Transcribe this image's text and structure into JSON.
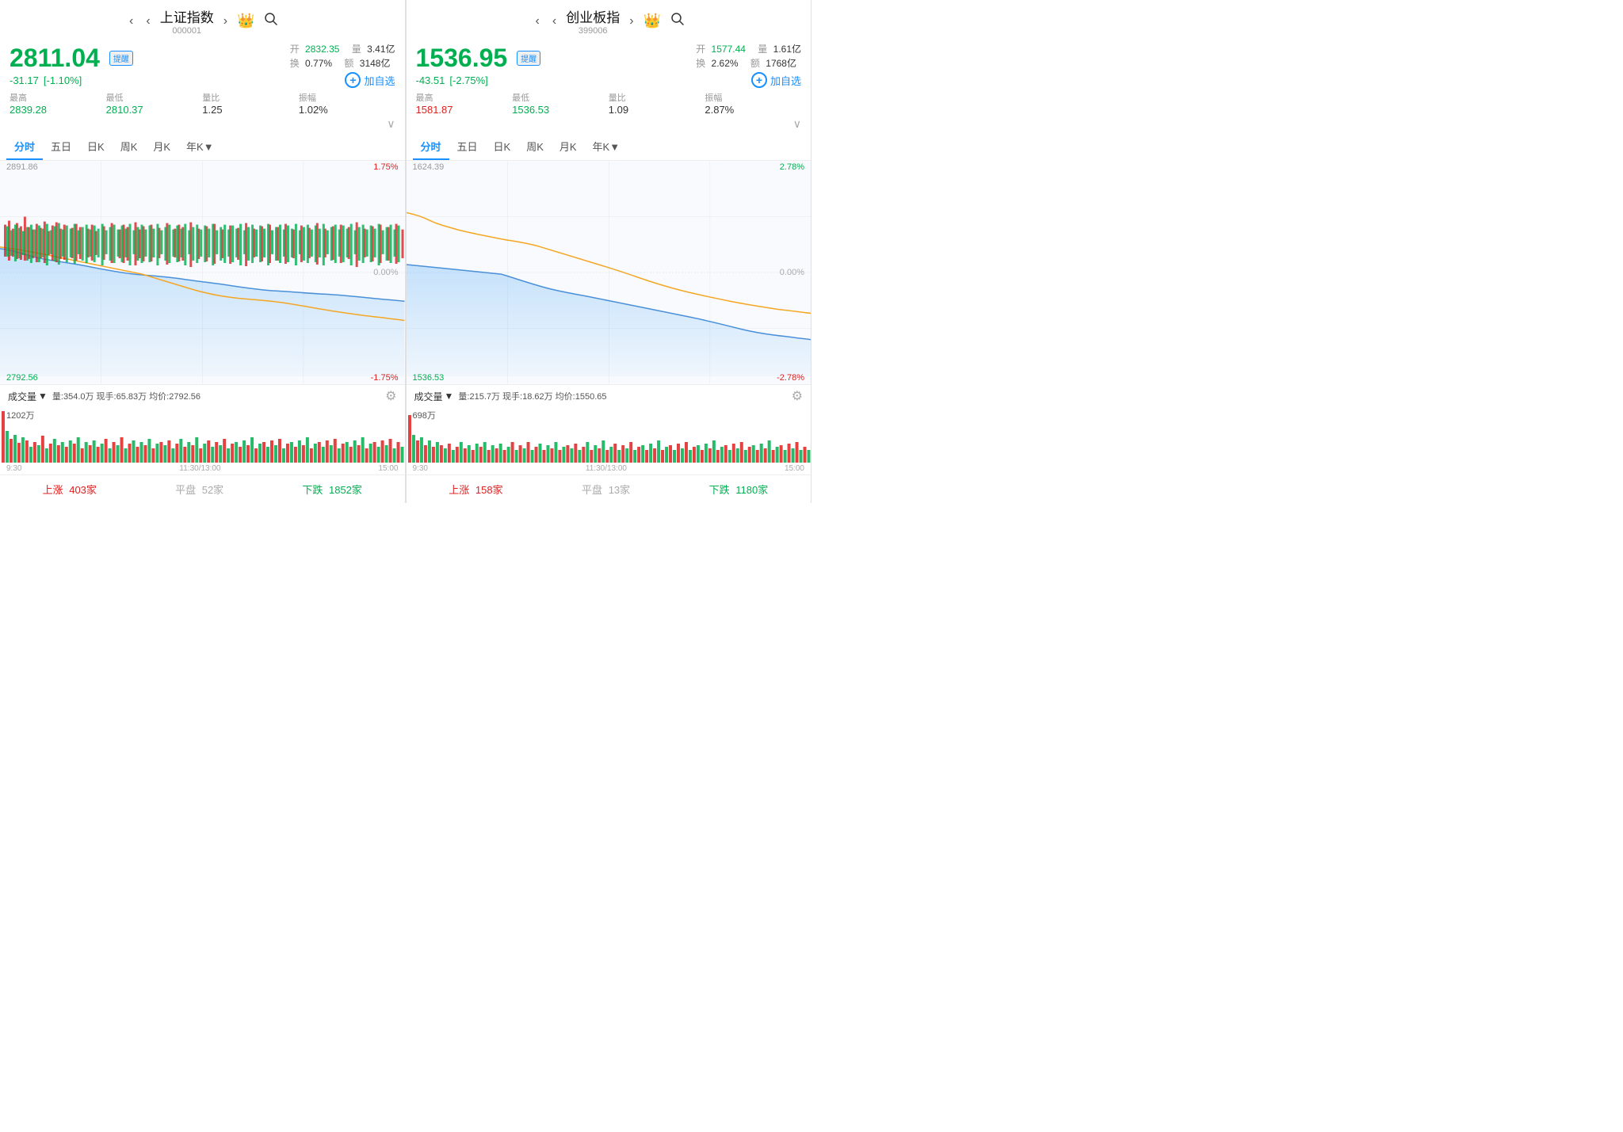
{
  "left": {
    "title": "上证指数",
    "code": "000001",
    "price": "2811.04",
    "change": "-31.17",
    "changePct": "[-1.10%]",
    "alertLabel": "提醒",
    "addLabel": "加自选",
    "open": "2832.35",
    "openLabel": "开",
    "volume": "3.41亿",
    "volumeLabel": "量",
    "turnover": "0.77%",
    "turnoverLabel": "换",
    "amount": "3148亿",
    "amountLabel": "额",
    "high": "2839.28",
    "highLabel": "最高",
    "low": "2810.37",
    "lowLabel": "最低",
    "volRatio": "1.25",
    "volRatioLabel": "量比",
    "amplitude": "1.02%",
    "amplitudeLabel": "振幅",
    "chartTopLeft": "2891.86",
    "chartTopRight": "1.75%",
    "chartMidRight": "0.00%",
    "chartBotLeft": "2792.56",
    "chartBotRight": "-1.75%",
    "tabs": [
      "分时",
      "五日",
      "日K",
      "周K",
      "月K",
      "年K▼"
    ],
    "activeTab": 0,
    "volHeaderLabel": "成交量",
    "volStats": "量:354.0万  现手:65.83万  均价:2792.56",
    "volTopLabel": "1202万",
    "timeLabels": [
      "9:30",
      "",
      "11:30/13:00",
      "",
      "15:00"
    ],
    "bottomUp": "上涨",
    "bottomUpCount": "403家",
    "bottomFlat": "平盘",
    "bottomFlatCount": "52家",
    "bottomDown": "下跌",
    "bottomDownCount": "1852家"
  },
  "right": {
    "title": "创业板指",
    "code": "399006",
    "price": "1536.95",
    "change": "-43.51",
    "changePct": "[-2.75%]",
    "alertLabel": "提醒",
    "addLabel": "加自选",
    "open": "1577.44",
    "openLabel": "开",
    "volume": "1.61亿",
    "volumeLabel": "量",
    "turnover": "2.62%",
    "turnoverLabel": "换",
    "amount": "1768亿",
    "amountLabel": "额",
    "high": "1581.87",
    "highLabel": "最高",
    "low": "1536.53",
    "lowLabel": "最低",
    "volRatio": "1.09",
    "volRatioLabel": "量比",
    "amplitude": "2.87%",
    "amplitudeLabel": "振幅",
    "chartTopLeft": "1624.39",
    "chartTopRight": "2.78%",
    "chartMidRight": "0.00%",
    "chartBotLeft": "1536.53",
    "chartBotRight": "-2.78%",
    "tabs": [
      "分时",
      "五日",
      "日K",
      "周K",
      "月K",
      "年K▼"
    ],
    "activeTab": 0,
    "volHeaderLabel": "成交量",
    "volStats": "量:215.7万  现手:18.62万  均价:1550.65",
    "volTopLabel": "698万",
    "timeLabels": [
      "9:30",
      "",
      "11:30/13:00",
      "",
      "15:00"
    ],
    "bottomUp": "上涨",
    "bottomUpCount": "158家",
    "bottomFlat": "平盘",
    "bottomFlatCount": "13家",
    "bottomDown": "下跌",
    "bottomDownCount": "1180家"
  }
}
